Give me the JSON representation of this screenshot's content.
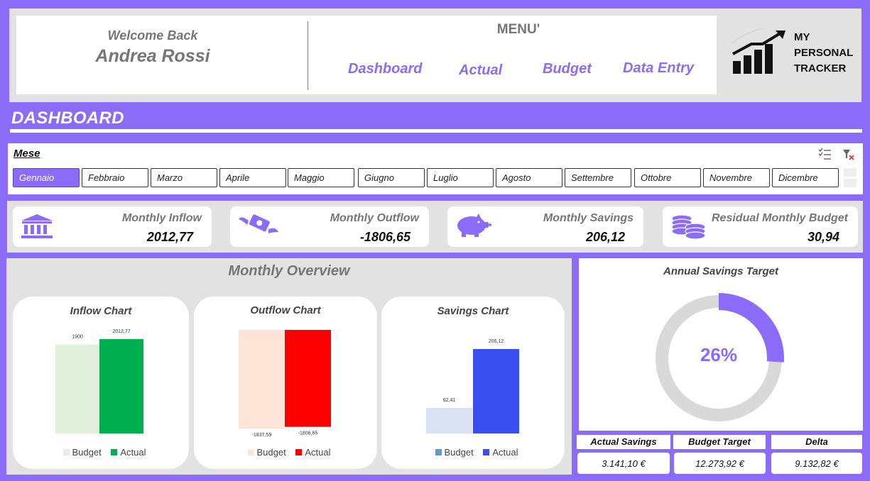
{
  "header": {
    "welcome": "Welcome Back",
    "user_name": "Andrea Rossi",
    "menu_title": "MENU'",
    "nav": [
      "Dashboard",
      "Actual",
      "Budget",
      "Data Entry"
    ],
    "logo_lines": [
      "MY",
      "PERSONAL",
      "TRACKER"
    ]
  },
  "page_title": "DASHBOARD",
  "slicer": {
    "title": "Mese",
    "months": [
      "Gennaio",
      "Febbraio",
      "Marzo",
      "Aprile",
      "Maggio",
      "Giugno",
      "Luglio",
      "Agosto",
      "Settembre",
      "Ottobre",
      "Novembre",
      "Dicembre"
    ],
    "selected": "Gennaio"
  },
  "kpis": [
    {
      "label": "Monthly Inflow",
      "value": "2012,77",
      "icon": "bank-icon"
    },
    {
      "label": "Monthly Outflow",
      "value": "-1806,65",
      "icon": "flying-money-icon"
    },
    {
      "label": "Monthly Savings",
      "value": "206,12",
      "icon": "piggy-bank-icon"
    },
    {
      "label": "Residual Monthly Budget",
      "value": "30,94",
      "icon": "coins-icon"
    }
  ],
  "overview_title": "Monthly Overview",
  "chart_data": [
    {
      "type": "bar",
      "title": "Inflow Chart",
      "categories": [
        "Budget",
        "Actual"
      ],
      "values": [
        1900,
        2012.77
      ],
      "value_labels": [
        "1900",
        "2012,77"
      ],
      "colors": [
        "#e2efda",
        "#00b050"
      ],
      "legend": [
        "Budget",
        "Actual"
      ]
    },
    {
      "type": "bar",
      "title": "Outflow Chart",
      "categories": [
        "Budget",
        "Actual"
      ],
      "values": [
        -1837.59,
        -1806.65
      ],
      "value_labels": [
        "-1837,59",
        "-1806,65"
      ],
      "colors": [
        "#fce4d6",
        "#ff0000"
      ],
      "legend": [
        "Budget",
        "Actual"
      ]
    },
    {
      "type": "bar",
      "title": "Savings Chart",
      "categories": [
        "Budget",
        "Actual"
      ],
      "values": [
        62.41,
        206.12
      ],
      "value_labels": [
        "62,41",
        "206,12"
      ],
      "colors": [
        "#d9e1f2",
        "#3b4ff0"
      ],
      "legend": [
        "Budget",
        "Actual"
      ],
      "legend_colors": [
        "#5b9bd5",
        "#3b4ff0"
      ]
    }
  ],
  "annual": {
    "title": "Annual Savings Target",
    "progress": 0.26,
    "progress_label": "26%",
    "headers": [
      "Actual Savings",
      "Budget Target",
      "Delta"
    ],
    "values": [
      "3.141,10 €",
      "12.273,92 €",
      "9.132,82 €"
    ]
  },
  "colors": {
    "accent": "#8b6cf8",
    "panel": "#e2e2e2"
  }
}
